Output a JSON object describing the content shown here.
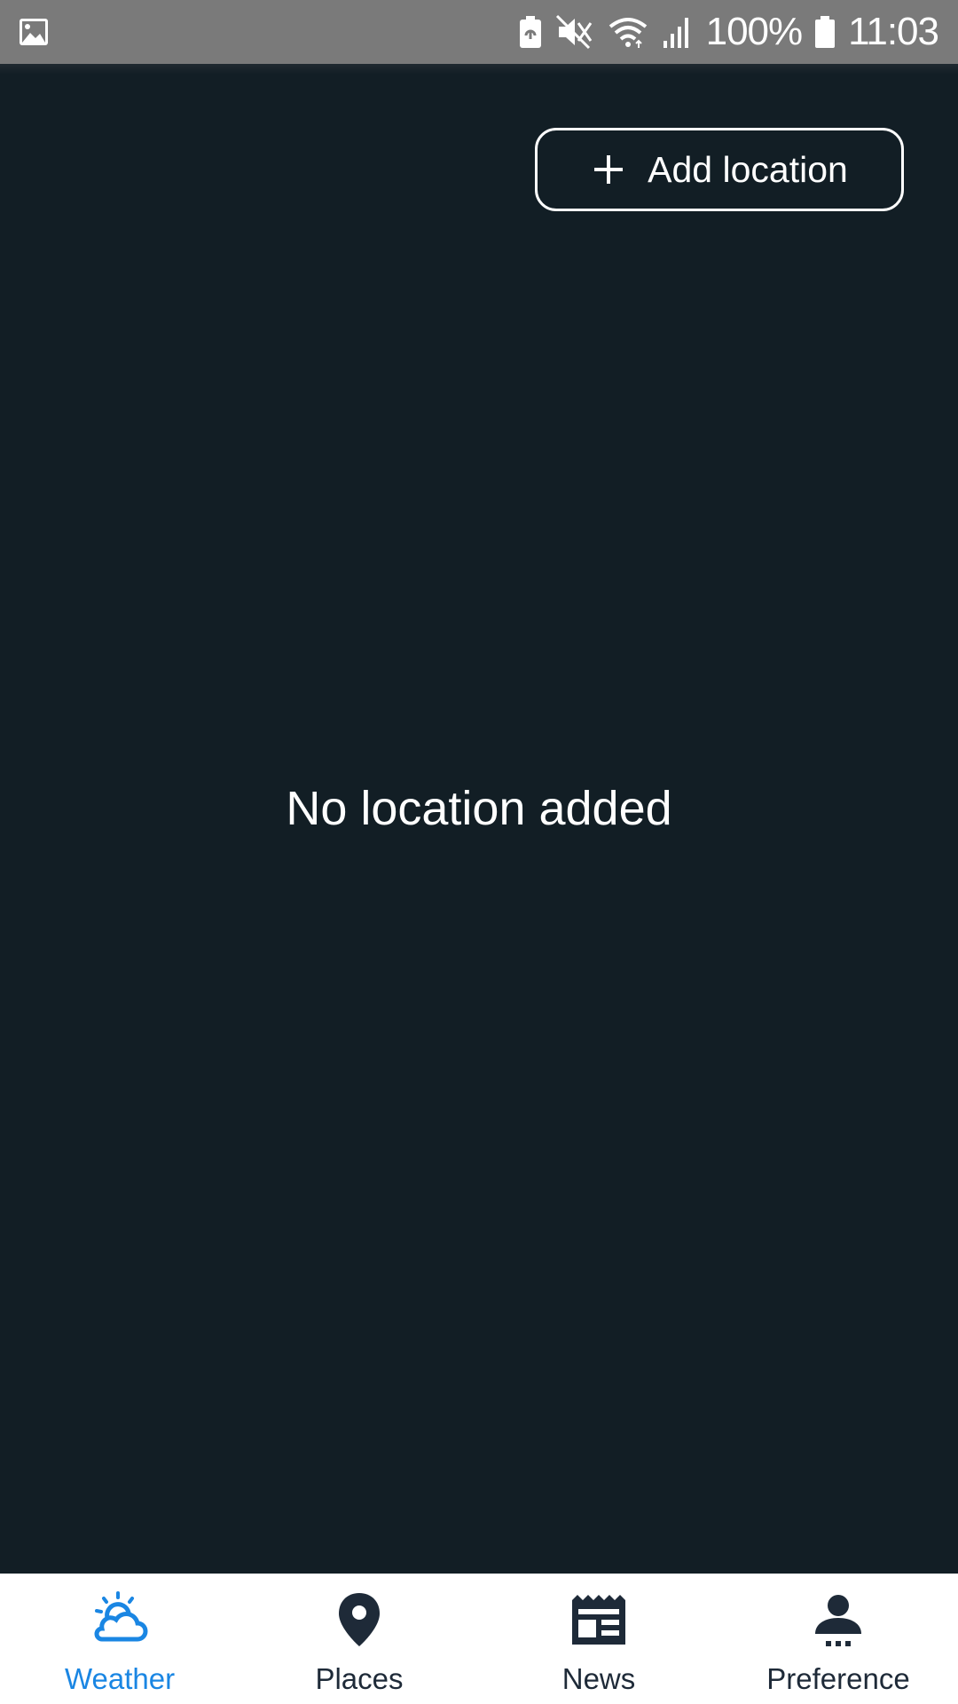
{
  "status_bar": {
    "battery_percent": "100%",
    "time": "11:03",
    "icons": [
      "gallery-icon",
      "battery-saver-icon",
      "mute-icon",
      "wifi-icon",
      "signal-icon",
      "battery-icon"
    ]
  },
  "main": {
    "add_location_label": "Add location",
    "empty_message": "No location added"
  },
  "bottom_nav": {
    "items": [
      {
        "label": "Weather",
        "icon": "weather-icon",
        "active": true
      },
      {
        "label": "Places",
        "icon": "location-pin-icon",
        "active": false
      },
      {
        "label": "News",
        "icon": "news-icon",
        "active": false
      },
      {
        "label": "Preference",
        "icon": "person-icon",
        "active": false
      }
    ]
  },
  "colors": {
    "background": "#121e25",
    "status_bar": "#7a7a7a",
    "accent": "#1a86e3",
    "nav_icon": "#1e2a38"
  }
}
